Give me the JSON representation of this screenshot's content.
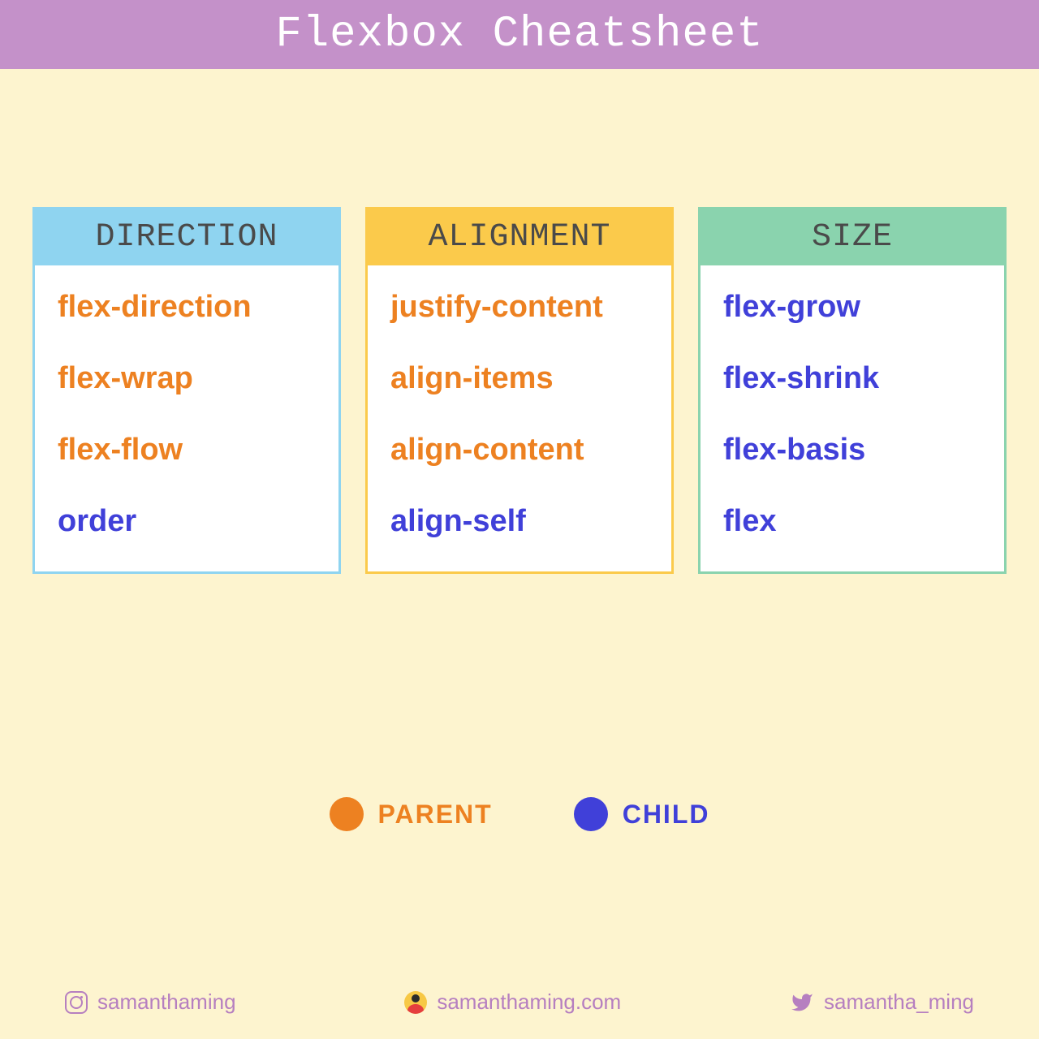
{
  "header": {
    "title": "Flexbox Cheatsheet"
  },
  "colors": {
    "parent": "#ed8121",
    "child": "#4040d9",
    "header_bg": "#c491c9",
    "page_bg": "#fdf4cf",
    "direction_border": "#8fd4f0",
    "alignment_border": "#fbca4b",
    "size_border": "#8ad3ae",
    "footer_text": "#b67fc0"
  },
  "cards": [
    {
      "title": "DIRECTION",
      "items": [
        {
          "label": "flex-direction",
          "kind": "parent"
        },
        {
          "label": "flex-wrap",
          "kind": "parent"
        },
        {
          "label": "flex-flow",
          "kind": "parent"
        },
        {
          "label": "order",
          "kind": "child"
        }
      ]
    },
    {
      "title": "ALIGNMENT",
      "items": [
        {
          "label": "justify-content",
          "kind": "parent"
        },
        {
          "label": "align-items",
          "kind": "parent"
        },
        {
          "label": "align-content",
          "kind": "parent"
        },
        {
          "label": "align-self",
          "kind": "child"
        }
      ]
    },
    {
      "title": "SIZE",
      "items": [
        {
          "label": "flex-grow",
          "kind": "child"
        },
        {
          "label": "flex-shrink",
          "kind": "child"
        },
        {
          "label": "flex-basis",
          "kind": "child"
        },
        {
          "label": "flex",
          "kind": "child"
        }
      ]
    }
  ],
  "legend": {
    "parent": "PARENT",
    "child": "CHILD"
  },
  "footer": {
    "instagram": {
      "icon": "instagram-icon",
      "handle": "samanthaming"
    },
    "website": {
      "icon": "avatar-icon",
      "handle": "samanthaming.com"
    },
    "twitter": {
      "icon": "twitter-icon",
      "handle": "samantha_ming"
    }
  }
}
